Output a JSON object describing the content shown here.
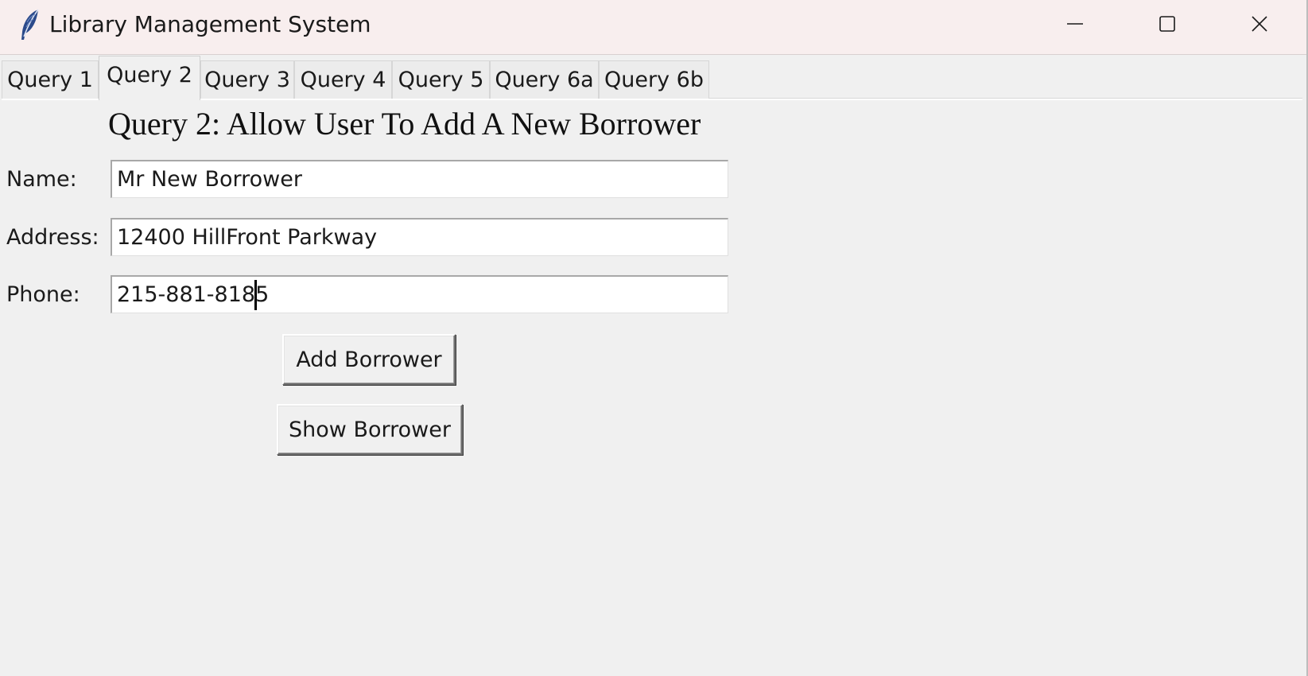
{
  "window": {
    "title": "Library Management System",
    "icon": "feather-icon",
    "controls": [
      "minimize-icon",
      "maximize-icon",
      "close-icon"
    ]
  },
  "tabs": [
    {
      "label": "Query 1",
      "active": false
    },
    {
      "label": "Query 2",
      "active": true
    },
    {
      "label": "Query 3",
      "active": false
    },
    {
      "label": "Query 4",
      "active": false
    },
    {
      "label": "Query 5",
      "active": false
    },
    {
      "label": "Query 6a",
      "active": false
    },
    {
      "label": "Query 6b",
      "active": false
    }
  ],
  "form": {
    "heading": "Query 2: Allow User To Add A New Borrower",
    "name_label": "Name:",
    "name_value": "Mr New Borrower",
    "address_label": "Address:",
    "address_value": "12400 HillFront Parkway",
    "phone_label": "Phone:",
    "phone_value": "215-881-8185",
    "add_button": "Add Borrower",
    "show_button": "Show Borrower"
  },
  "colors": {
    "titlebar_bg": "#f8eeee",
    "window_bg": "#f0f0f0",
    "input_bg": "#ffffff",
    "text": "#1a1a1a"
  }
}
